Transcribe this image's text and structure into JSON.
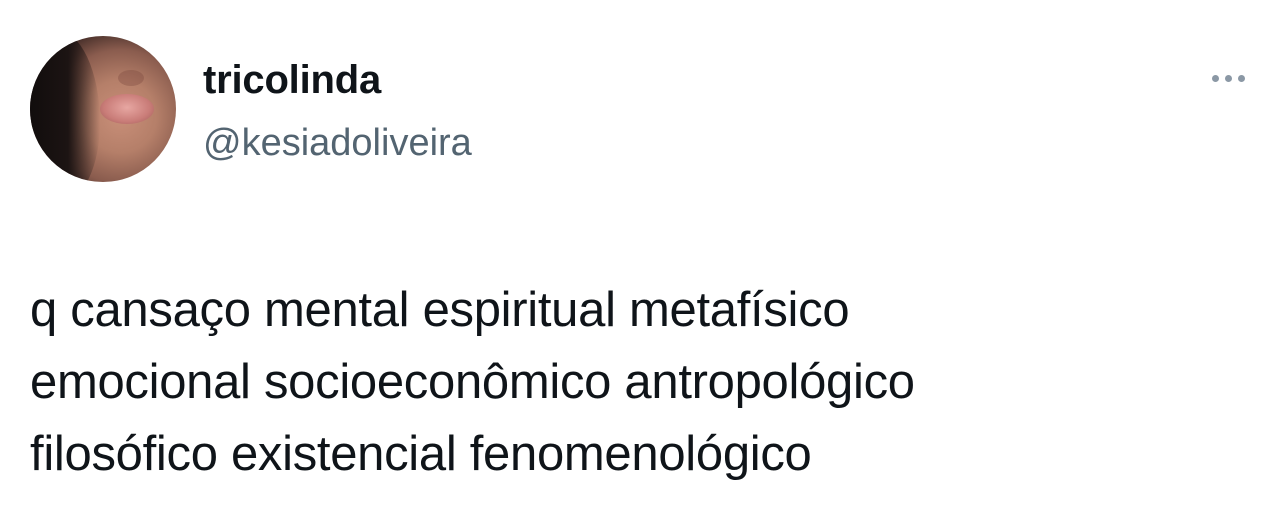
{
  "author": {
    "display_name": "tricolinda",
    "handle": "@kesiadoliveira",
    "avatar_icon": "profile-photo"
  },
  "menu": {
    "icon": "more-horizontal-icon"
  },
  "tweet": {
    "text": "q cansaço mental espiritual metafísico\nemocional socioeconômico antropológico\nfilosófico existencial fenomenológico"
  },
  "colors": {
    "text_primary": "#0f1419",
    "text_secondary": "#536471",
    "icon_gray": "#8b98a5",
    "background": "#ffffff"
  }
}
